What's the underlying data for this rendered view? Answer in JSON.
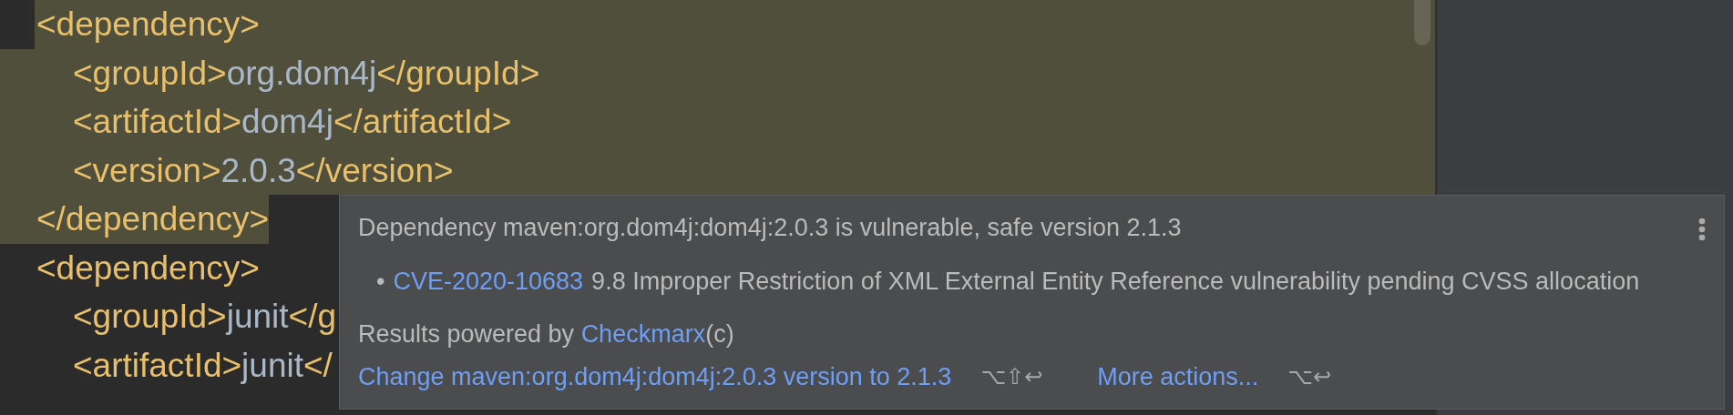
{
  "editor": {
    "elements": [
      {
        "open": "<dependency>",
        "close": "</dependency>",
        "selected": true,
        "children": [
          {
            "segments": [
              {
                "kind": "tag",
                "text": "<groupId>"
              },
              {
                "kind": "value",
                "text": "org.dom4j"
              },
              {
                "kind": "tag",
                "text": "</groupId>"
              }
            ]
          },
          {
            "segments": [
              {
                "kind": "tag",
                "text": "<artifactId>"
              },
              {
                "kind": "value",
                "text": "dom4j"
              },
              {
                "kind": "tag",
                "text": "</artifactId>"
              }
            ]
          },
          {
            "segments": [
              {
                "kind": "tag",
                "text": "<version>"
              },
              {
                "kind": "value",
                "text": "2.0.3"
              },
              {
                "kind": "tag",
                "text": "</version>"
              }
            ]
          }
        ]
      },
      {
        "open": "<dependency>",
        "selected": false,
        "children": [
          {
            "segments": [
              {
                "kind": "tag",
                "text": "<groupId>"
              },
              {
                "kind": "value",
                "text": "junit"
              },
              {
                "kind": "tag",
                "text": "</g"
              }
            ]
          },
          {
            "segments": [
              {
                "kind": "tag",
                "text": "<artifactId>"
              },
              {
                "kind": "value",
                "text": "junit"
              },
              {
                "kind": "tag",
                "text": "</"
              }
            ]
          }
        ]
      }
    ]
  },
  "popup": {
    "title": "Dependency maven:org.dom4j:dom4j:2.0.3 is vulnerable, safe version 2.1.3",
    "issues": [
      {
        "bullet": "•",
        "id": "CVE-2020-10683",
        "description": "9.8 Improper Restriction of XML External Entity Reference vulnerability pending CVSS allocation"
      }
    ],
    "attribution": {
      "prefix": "Results powered by ",
      "link": "Checkmarx",
      "suffix": "(c)"
    },
    "actions": [
      {
        "label": "Change maven:org.dom4j:dom4j:2.0.3 version to 2.1.3",
        "shortcut": "⌥⇧↩"
      },
      {
        "label": "More actions...",
        "shortcut": "⌥↩"
      }
    ]
  }
}
